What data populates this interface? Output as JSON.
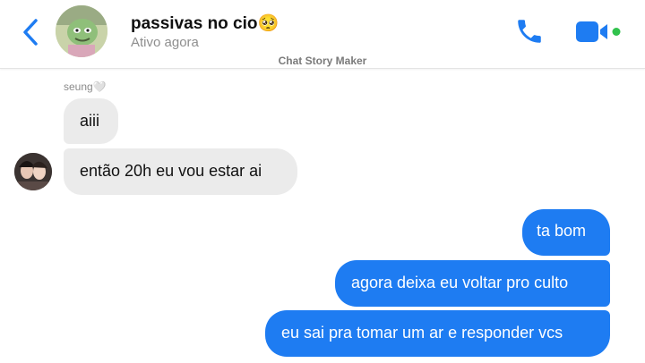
{
  "header": {
    "title": "passivas no cio🥺",
    "status": "Ativo agora",
    "watermark": "Chat Story Maker",
    "icons": {
      "back": "chevron-left-icon",
      "call": "phone-icon",
      "video": "video-camera-icon"
    },
    "accent_color": "#1e7cf2",
    "online_color": "#31c24d"
  },
  "conversation": {
    "sender_name": "seung🤍",
    "messages": [
      {
        "direction": "incoming",
        "text": "aiii"
      },
      {
        "direction": "incoming",
        "text": "então 20h eu vou estar ai"
      },
      {
        "direction": "outgoing",
        "text": "ta bom"
      },
      {
        "direction": "outgoing",
        "text": "agora deixa eu voltar pro culto"
      },
      {
        "direction": "outgoing",
        "text": "eu sai pra tomar um ar e responder vcs"
      }
    ],
    "colors": {
      "incoming_bubble": "#ebebeb",
      "outgoing_bubble": "#1e7cf2"
    }
  }
}
